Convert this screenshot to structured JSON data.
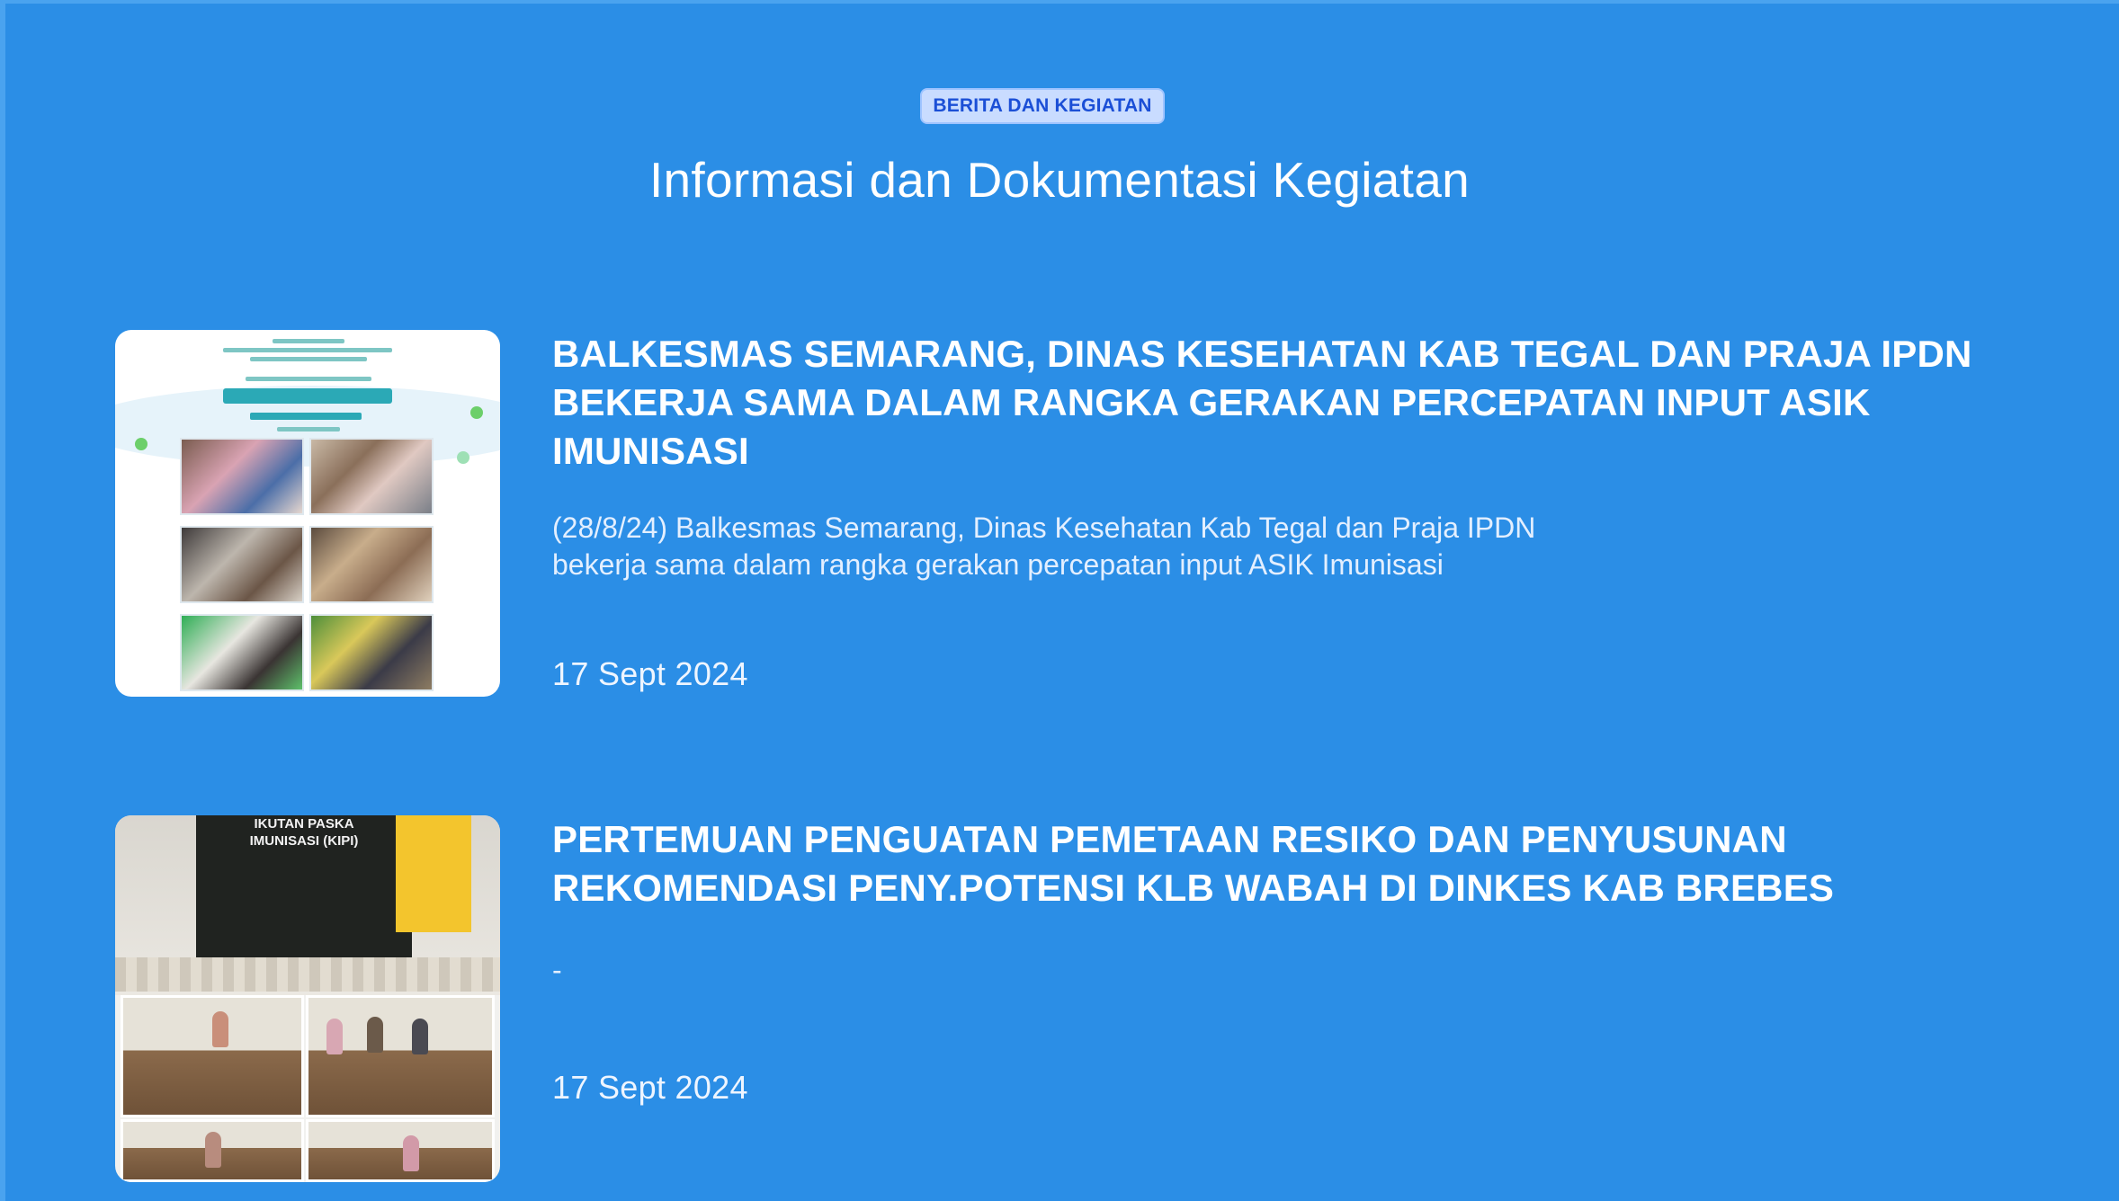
{
  "section": {
    "badge": "BERITA DAN KEGIATAN",
    "title": "Informasi dan Dokumentasi Kegiatan"
  },
  "news": [
    {
      "title": "BALKESMAS SEMARANG, DINAS KESEHATAN KAB TEGAL DAN PRAJA IPDN BEKERJA SAMA DALAM RANGKA GERAKAN PERCEPATAN INPUT ASIK IMUNISASI",
      "excerpt": "(28/8/24) Balkesmas Semarang, Dinas Kesehatan Kab Tegal  dan Praja IPDN bekerja sama dalam rangka gerakan percepatan input ASIK Imunisasi",
      "date": "17 Sept 2024"
    },
    {
      "title": "PERTEMUAN PENGUATAN PEMETAAN RESIKO DAN PENYUSUNAN REKOMENDASI PENY.POTENSI KLB WABAH DI DINKES KAB BREBES",
      "excerpt": "-",
      "date": "17 Sept 2024",
      "image_text": "IKUTAN PASKA\nIMUNISASI (KIPI)"
    }
  ],
  "colors": {
    "background": "#2b8ee6",
    "badge_bg": "#c9dcff",
    "badge_text": "#1b4fd6",
    "text": "#ffffff"
  }
}
